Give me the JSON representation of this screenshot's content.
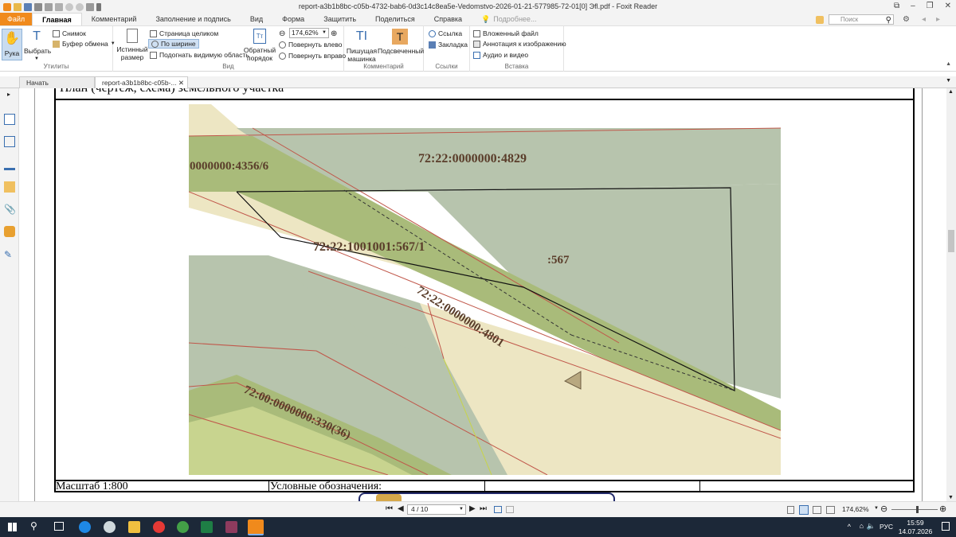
{
  "window": {
    "title": "report-a3b1b8bc-c05b-4732-bab6-0d3c14c8ea5e-Vedomstvo-2026-01-21-577985-72-01[0] Эfl.pdf - Foxit Reader"
  },
  "menu": {
    "file": "Файл",
    "tabs": [
      "Главная",
      "Комментарий",
      "Заполнение и подпись",
      "Вид",
      "Форма",
      "Защитить",
      "Поделиться",
      "Справка"
    ],
    "active_tab": "Главная",
    "hint": "Подробнее...",
    "search_placeholder": "Поиск"
  },
  "ribbon": {
    "tools_group": {
      "label": "Утилиты",
      "hand": "Рука",
      "select": "Выбрать",
      "snapshot": "Снимок",
      "clipboard": "Буфер обмена"
    },
    "view_group": {
      "label": "Вид",
      "actual_size_1": "Истинный",
      "actual_size_2": "размер",
      "fit_page": "Страница целиком",
      "fit_width": "По ширине",
      "fit_visible": "Подогнать видимую область",
      "reverse_1": "Обратный",
      "reverse_2": "порядок",
      "zoom_value": "174,62%",
      "rotate_left": "Повернуть влево",
      "rotate_right": "Повернуть вправо"
    },
    "comment_group": {
      "label": "Комментарий",
      "typewriter_1": "Пишущая",
      "typewriter_2": "машинка",
      "highlight": "Подсвеченный"
    },
    "links_group": {
      "label": "Ссылки",
      "link": "Ссылка",
      "bookmark": "Закладка"
    },
    "insert_group": {
      "label": "Вставка",
      "attachment": "Вложенный файл",
      "image_annotation": "Аннотация к изображению",
      "audio_video": "Аудио и видео"
    }
  },
  "doc_tabs": {
    "start": "Начать",
    "file": "report-a3b1b8bc-c05b-..."
  },
  "document": {
    "heading": "План (чертеж, схема) земельного участка",
    "scale": "Масштаб 1:800",
    "legend": "Условные обозначения:",
    "map_labels": {
      "l4829": "72:22:0000000:4829",
      "l4356": ":0000000:4356/6",
      "l567_1": "72:22:1001001:567/1",
      "l567": ":567",
      "l4801": "72:22:0000000:4801",
      "l330": "72:00:0000000:330(36)"
    }
  },
  "status": {
    "page": "4 / 10",
    "zoom": "174,62%"
  },
  "taskbar": {
    "lang": "РУС",
    "time": "15:59",
    "date": "14.07.2026"
  },
  "colors": {
    "accent": "#f08a1c",
    "taskbar": "#1c2838",
    "parcel_grey": "#b7c4ad",
    "parcel_green": "#a9bb7a",
    "parcel_beige": "#ede6c3",
    "boundary_red": "#c0574a"
  }
}
